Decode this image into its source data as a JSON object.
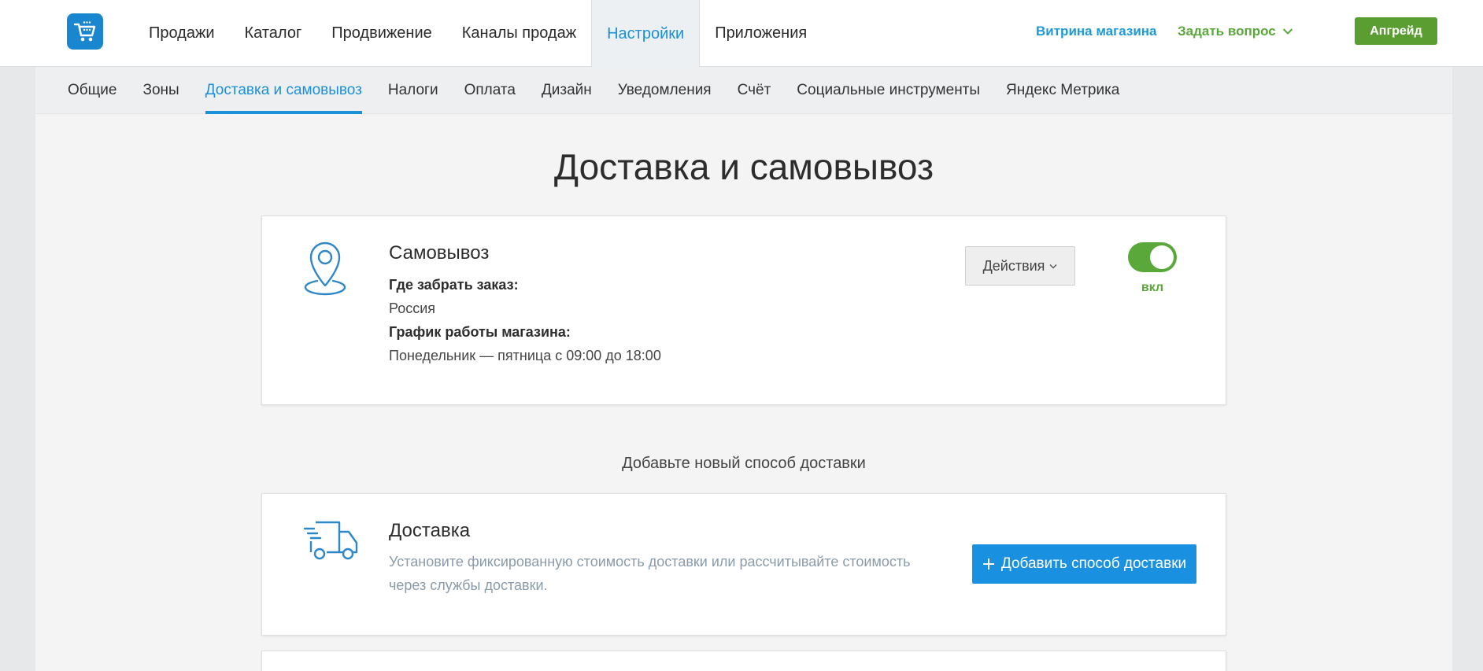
{
  "header": {
    "logo_icon": "cart-logo-icon",
    "nav": [
      {
        "label": "Продажи"
      },
      {
        "label": "Каталог"
      },
      {
        "label": "Продвижение"
      },
      {
        "label": "Каналы продаж"
      },
      {
        "label": "Настройки",
        "active": true
      },
      {
        "label": "Приложения"
      }
    ],
    "storefront_link": "Витрина магазина",
    "ask_question": "Задать вопрос",
    "upgrade_button": "Апгрейд"
  },
  "subnav": {
    "items": [
      {
        "label": "Общие"
      },
      {
        "label": "Зоны"
      },
      {
        "label": "Доставка и самовывоз",
        "active": true
      },
      {
        "label": "Налоги"
      },
      {
        "label": "Оплата"
      },
      {
        "label": "Дизайн"
      },
      {
        "label": "Уведомления"
      },
      {
        "label": "Счёт"
      },
      {
        "label": "Социальные инструменты"
      },
      {
        "label": "Яндекс Метрика"
      }
    ]
  },
  "page": {
    "title": "Доставка и самовывоз",
    "pickup": {
      "icon": "map-pin-icon",
      "title": "Самовывоз",
      "where_label": "Где забрать заказ:",
      "where_value": "Россия",
      "schedule_label": "График работы магазина:",
      "schedule_value": "Понедельник — пятница с 09:00 до 18:00",
      "actions_button": "Действия",
      "toggle_on": true,
      "toggle_label": "вкл"
    },
    "add_heading": "Добавьте новый способ доставки",
    "delivery": {
      "icon": "truck-icon",
      "title": "Доставка",
      "description": "Установите фиксированную стоимость доставки или рассчитывайте стоимость через службы доставки.",
      "add_button": "Добавить способ доставки"
    }
  },
  "colors": {
    "accent_blue": "#1a90d8",
    "accent_green": "#5aa73a",
    "button_blue": "#1a90e0"
  }
}
